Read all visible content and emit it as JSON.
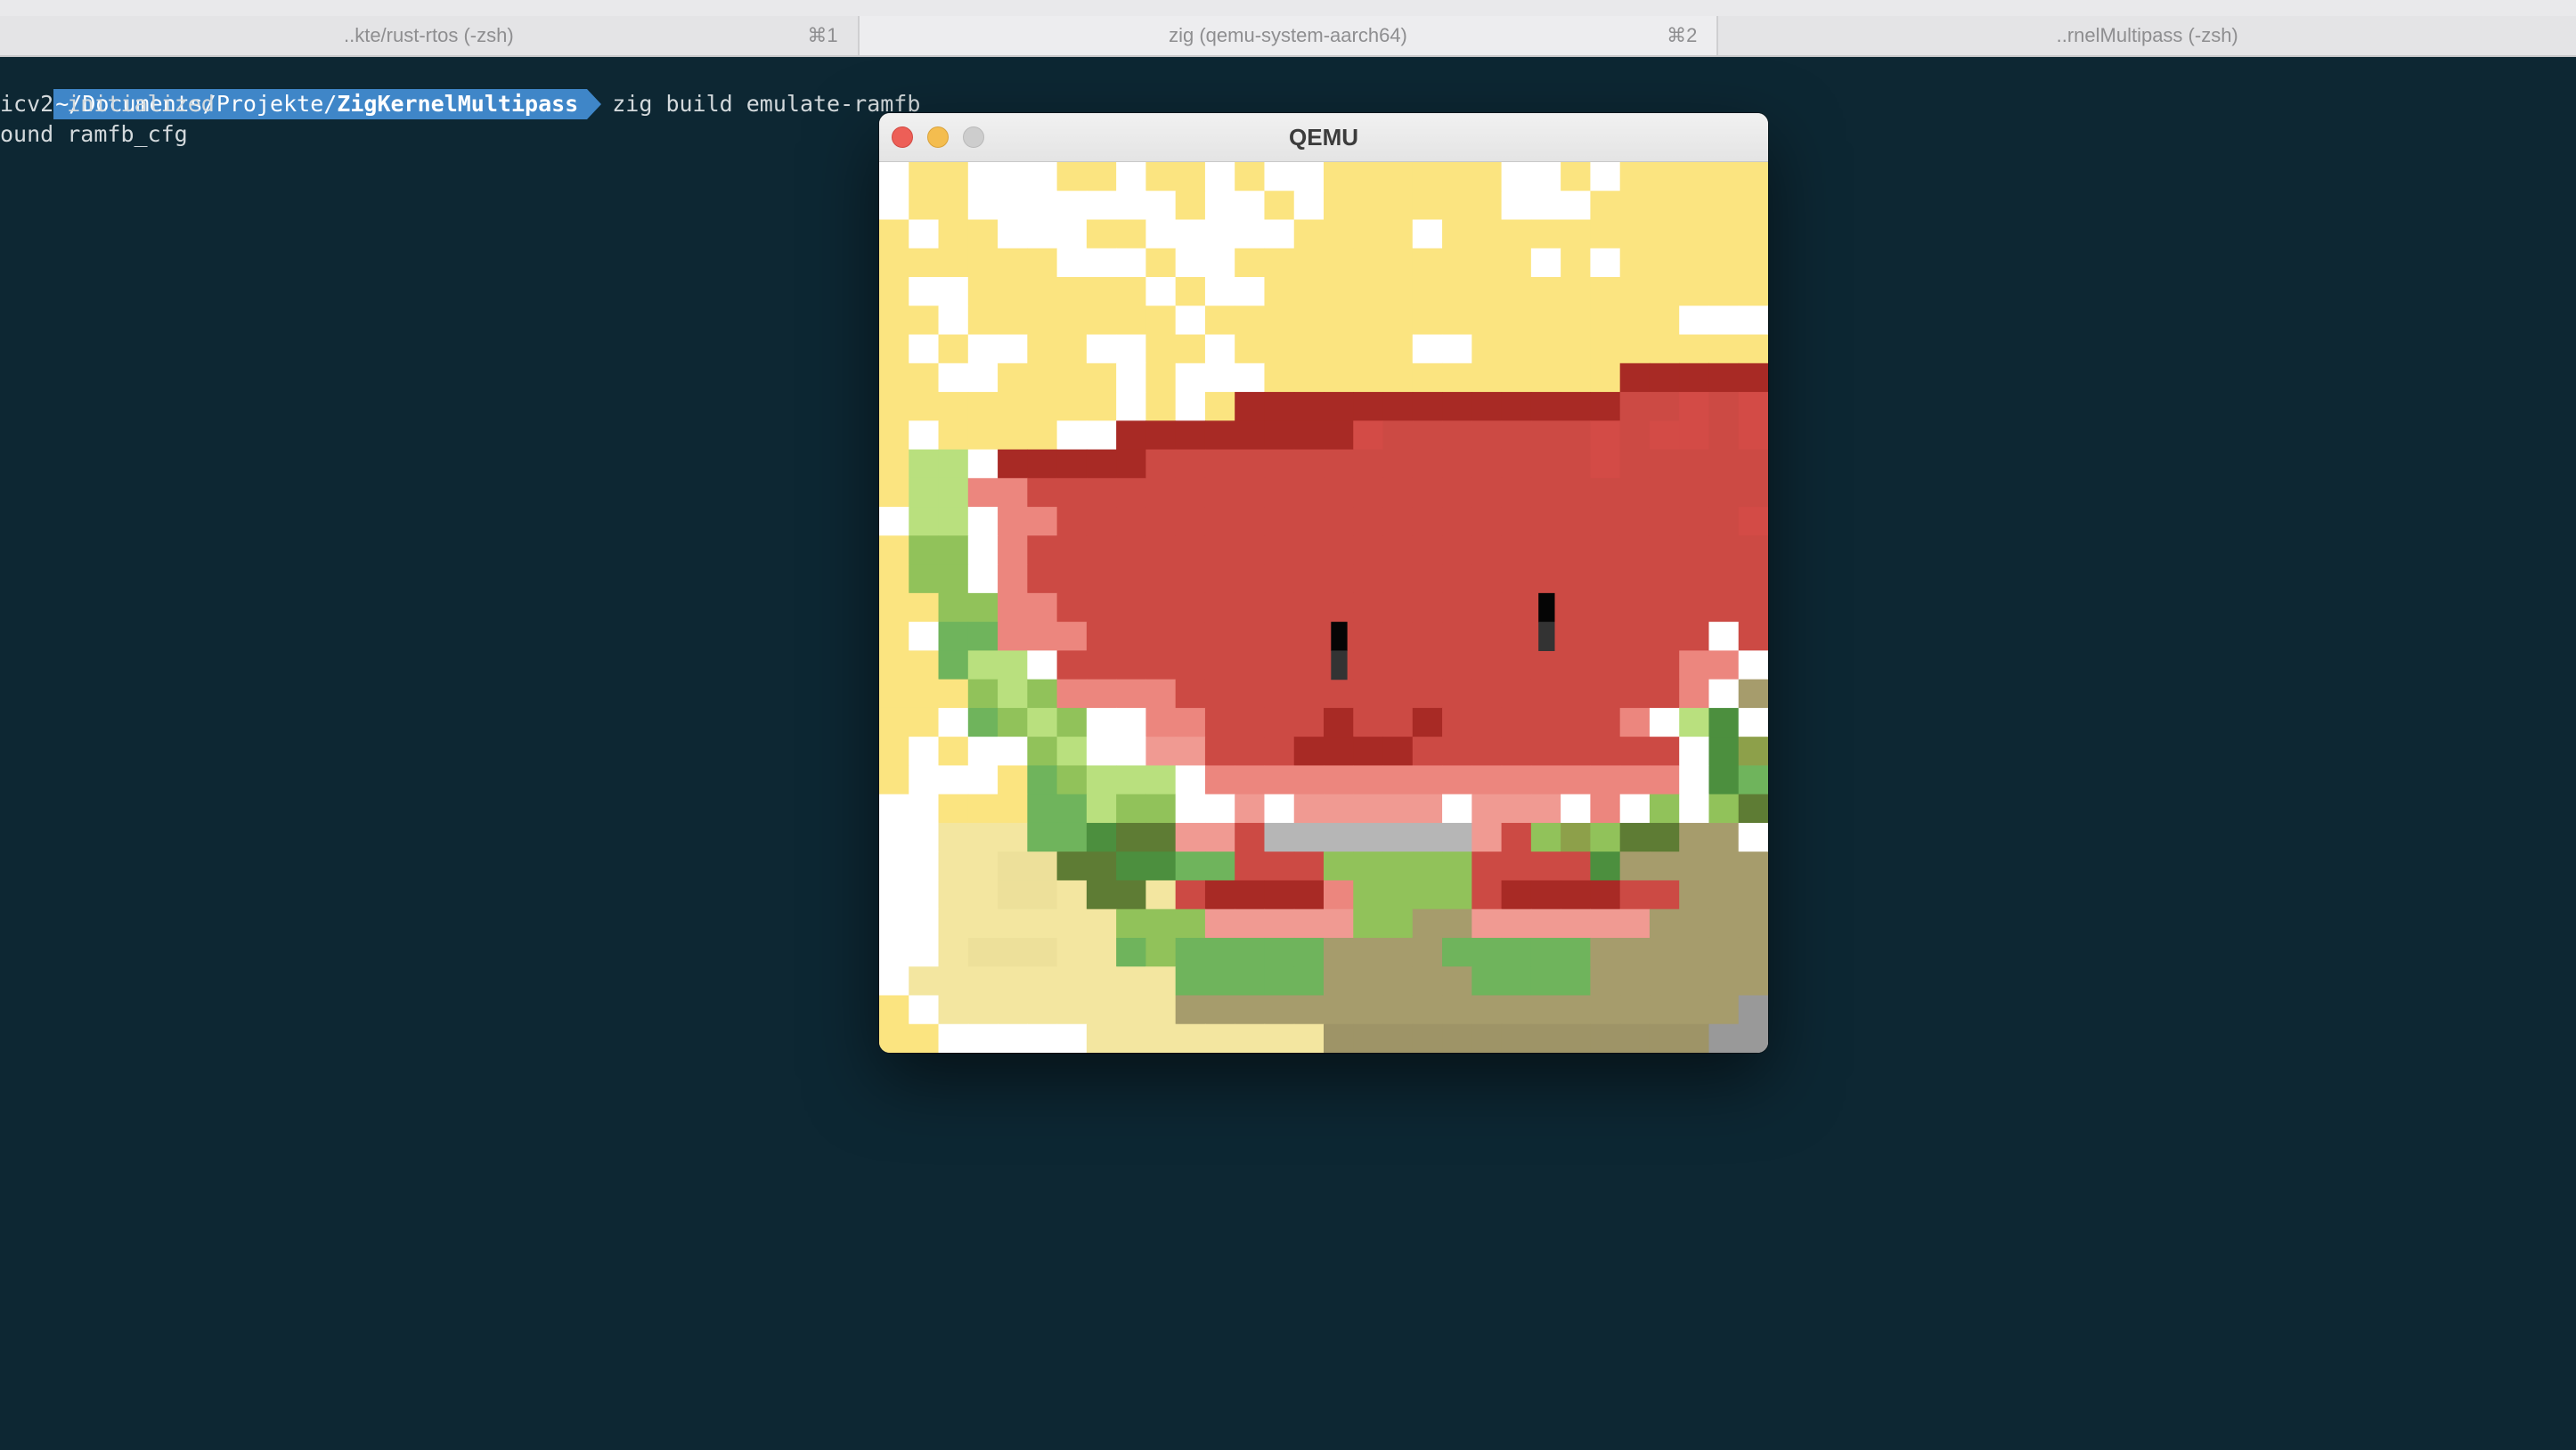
{
  "tabs": [
    {
      "title": "..kte/rust-rtos (-zsh)",
      "shortcut": "⌘1"
    },
    {
      "title": "zig (qemu-system-aarch64)",
      "shortcut": "⌘2"
    },
    {
      "title": "..rnelMultipass (-zsh)",
      "shortcut": ""
    }
  ],
  "terminal": {
    "prompt_path_dim": "~/Documents/Projekte/",
    "prompt_path_bold": "ZigKernelMultipass",
    "command": "zig build emulate-ramfb",
    "output": [
      "icv2 initialized",
      "ound ramfb_cfg"
    ]
  },
  "qemu_window": {
    "title": "QEMU",
    "framebuffer": {
      "palette": {
        ".": "#ffffff",
        "y": "#fbe480",
        "c": "#f3e6a0",
        "C": "#ede09a",
        "R": "#a82a25",
        "r": "#cc4a44",
        "d": "#d34b46",
        "p": "#ec867e",
        "q": "#f09a92",
        "g": "#b9e07e",
        "G": "#91c25a",
        "h": "#6fb45c",
        "D": "#4c8f3e",
        "E": "#5e7c34",
        "o": "#8da04a",
        "k": "#a69c6c",
        "K": "#9e9467",
        "s": "#b6b6b6",
        "S": "#999999",
        "b": "#050505",
        "B": "#333333"
      },
      "rows": [
        ".yy...yy.yy.y..yyyyyy..y.yyyyy",
        ".yy.......y..y.yyyyyy...yyyyyy",
        "y.yy...yy.....yyyy.yyyyyyyyyyy",
        "yyyyyy...y..yyyyyyyyyy.y.yyyyy",
        "y..yyyyyy.y..yyyyyyyyyyyyyyyyy",
        "yy.yyyyyyy.yyyyyyyyyyyyyyyy...",
        "y.y..yy..yy.yyyyyy..yyyyyyyyyy",
        "yy..yyyy.y...yyyyyyyyyyyyRRRRR",
        "yyyyyyyy.y.yRRRRRRRRRRRRRrrdrd",
        "y.yyyy..RRRRRRRRdrrrrrrrdrddrd",
        "ygg.RRRRRrrrrrrrrrrrrrrrdrrrrr",
        "yggpprrrrrrrrrrrrrrrrrrrrrrrrr",
        ".gg.pprrrrrrrrrrrrrrrrrrrrrrrd",
        "yGG.prrrrrrrrrrrrrrrrrrrrrrrrr",
        "yGG.prrrrrrrrrrrrrrrrrrrrrrrrr",
        "yyGGpprrrrrrrrrrrrrrrrrrrrrrrr",
        "y.hhppprrrrrrrrrrrrrrrrrrrrr.r",
        "yyhgg.rrrrrrrrrrrrrrrrrrrrrpp.",
        "yyyGgGpppprrrrrrrrrrrrrrrrrp.k",
        "yy.hGgG..pprrrrRrrRrrrrrrp.gD",
        "y.y..Gg..qqrrrRRRRrrrrrrrrr.Do",
        "y...yhGggg.pppppppppppppppp.Dh",
        "..yyyhhgGG..q.qqqqq.qqq.p.G.GE",
        "..ccchhDEEqqrsssssssqrGoGEEkk",
        "..ccCCEEDDhhrrrGGGGGrrrrDkkkkk",
        "..ccCCcEEcrRRRRpGGGGrRRRRrrkkk",
        "..ccccccGGGqqqqqGGkkqqqqqqkkkk",
        "..cCCCcchGhhhhhkkkkhhhhhkkkkkk",
        ".ccccccccchhhhhkkkkkhhhhkkkkkk",
        "y.cccccccckkkkkkkkkkkkkkkkkkkS",
        "yy.....ccccccccKKKKKKKKKKKKKSS"
      ],
      "eyes": [
        {
          "col": 15,
          "row": 16,
          "color": "b"
        },
        {
          "col": 15,
          "row": 17,
          "color": "B"
        },
        {
          "col": 22,
          "row": 15,
          "color": "b"
        },
        {
          "col": 22,
          "row": 16,
          "color": "B"
        }
      ]
    }
  }
}
